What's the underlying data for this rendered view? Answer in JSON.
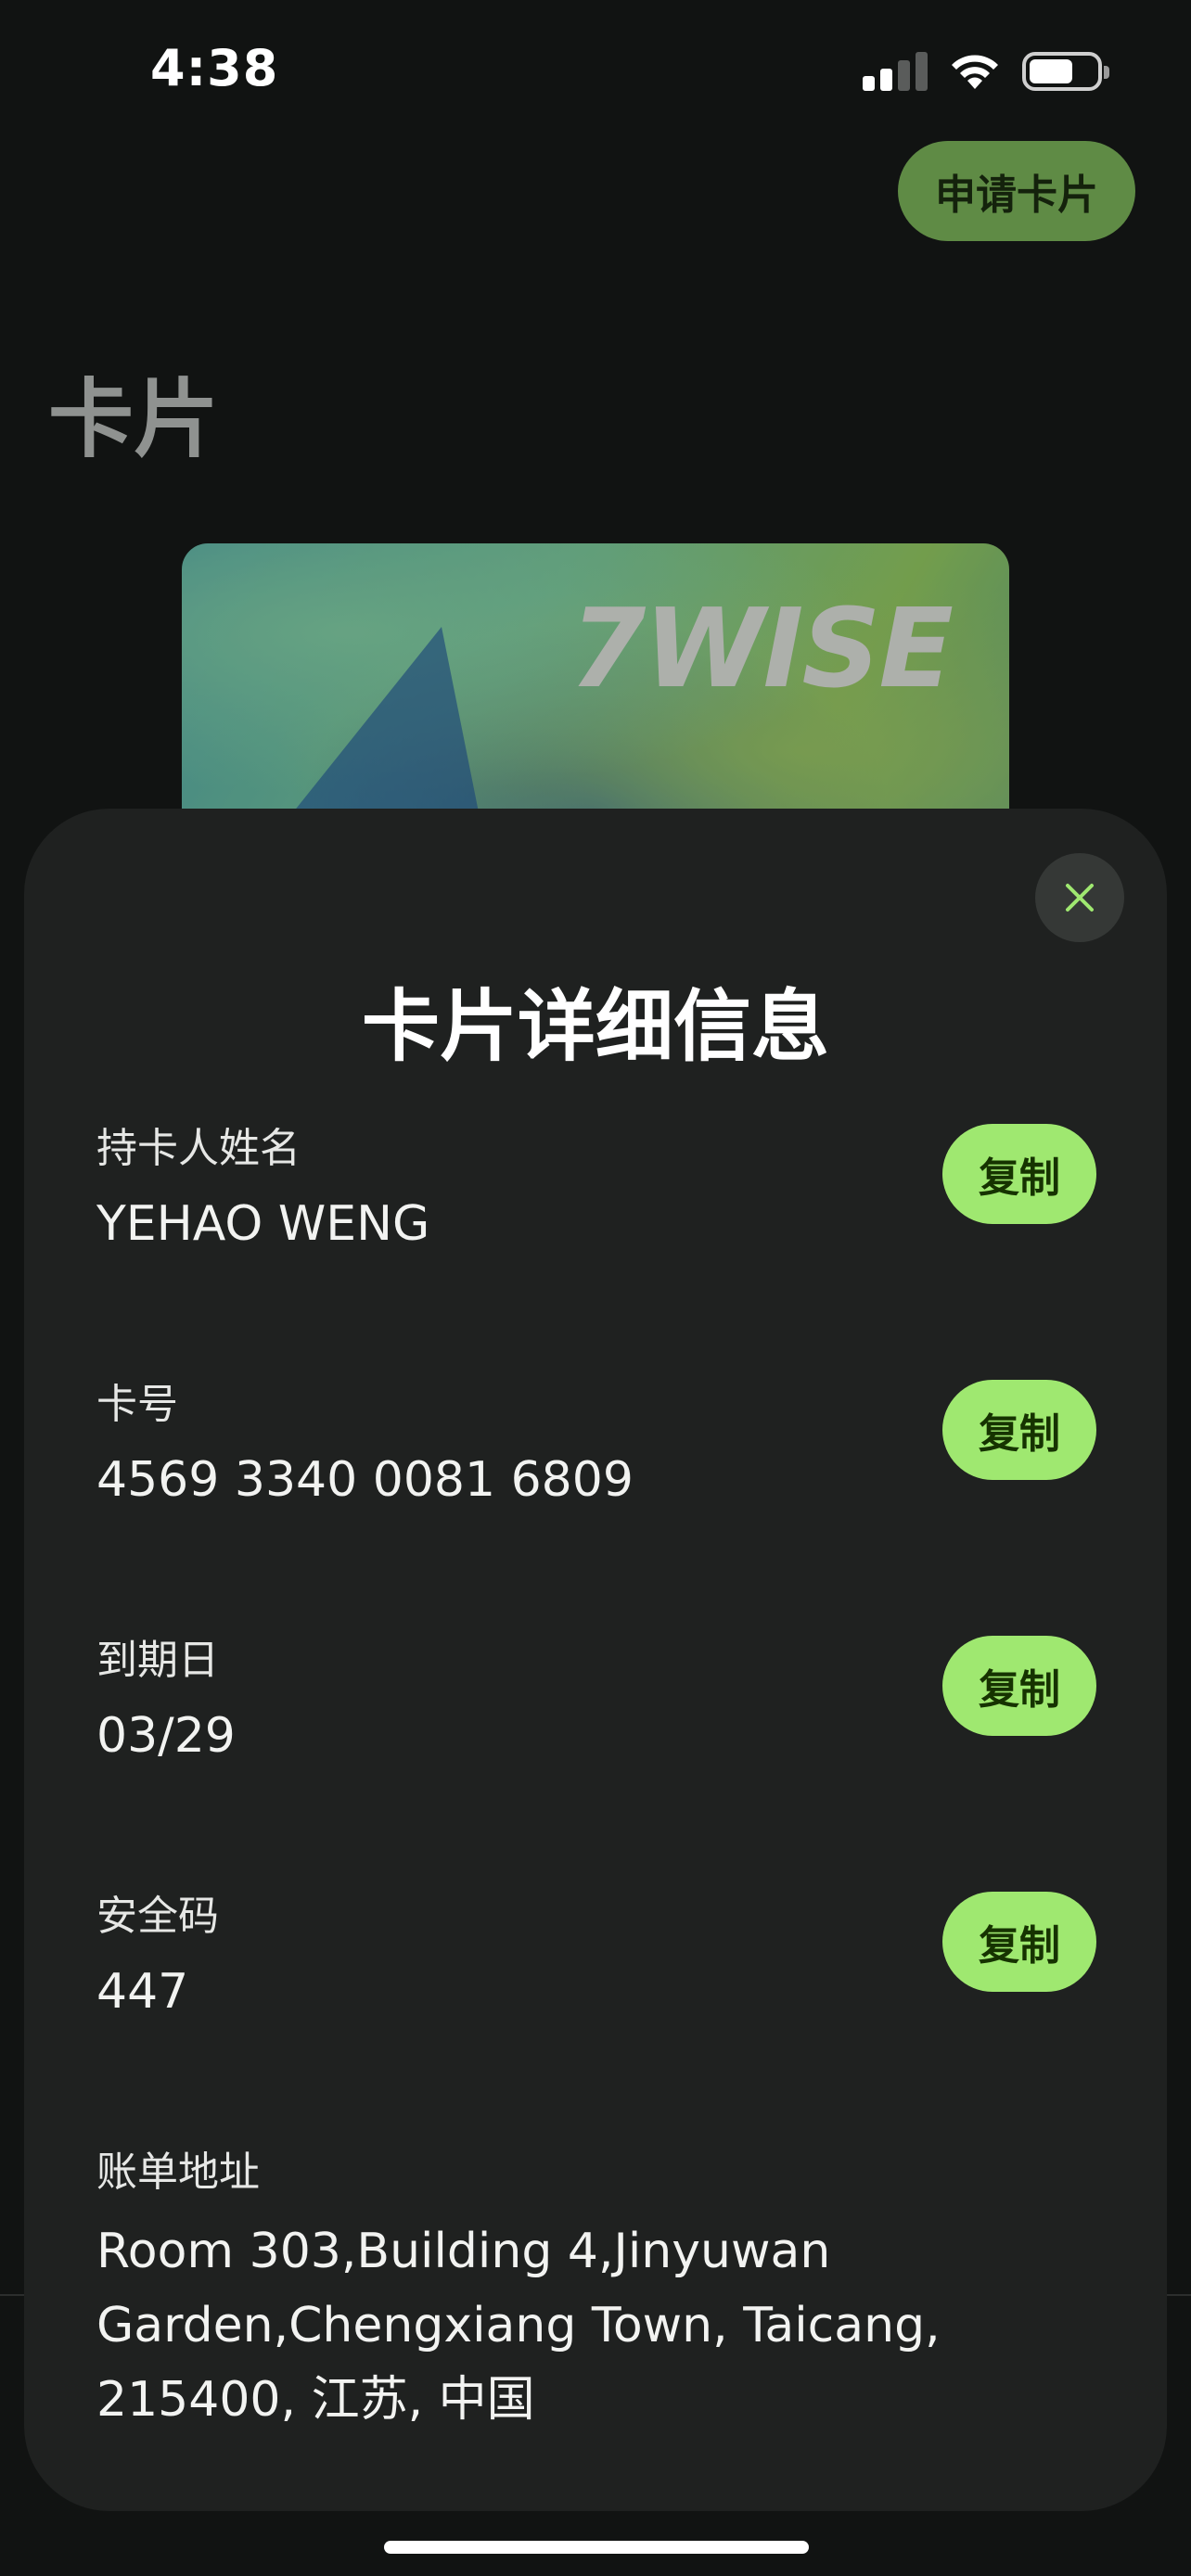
{
  "status_bar": {
    "time": "4:38",
    "icons": [
      "cellular-signal-icon",
      "wifi-icon",
      "battery-icon"
    ]
  },
  "header": {
    "apply_card_label": "申请卡片",
    "page_title": "卡片"
  },
  "card": {
    "brand": "7WISE"
  },
  "sheet": {
    "title": "卡片详细信息",
    "close_icon": "close-icon",
    "copy_label": "复制",
    "fields": [
      {
        "label": "持卡人姓名",
        "value": "YEHAO WENG"
      },
      {
        "label": "卡号",
        "value": "4569 3340 0081 6809"
      },
      {
        "label": "到期日",
        "value": "03/29"
      },
      {
        "label": "安全码",
        "value": "447"
      }
    ],
    "billing_address": {
      "label": "账单地址",
      "lines": [
        "Room 303,Building 4,Jinyuwan",
        "Garden,Chengxiang Town, Taicang,",
        "215400, 江苏, 中国"
      ]
    }
  },
  "colors": {
    "accent": "#9fe870",
    "accent_text": "#163300",
    "sheet_background": "#1f2120",
    "page_background": "#111312"
  }
}
